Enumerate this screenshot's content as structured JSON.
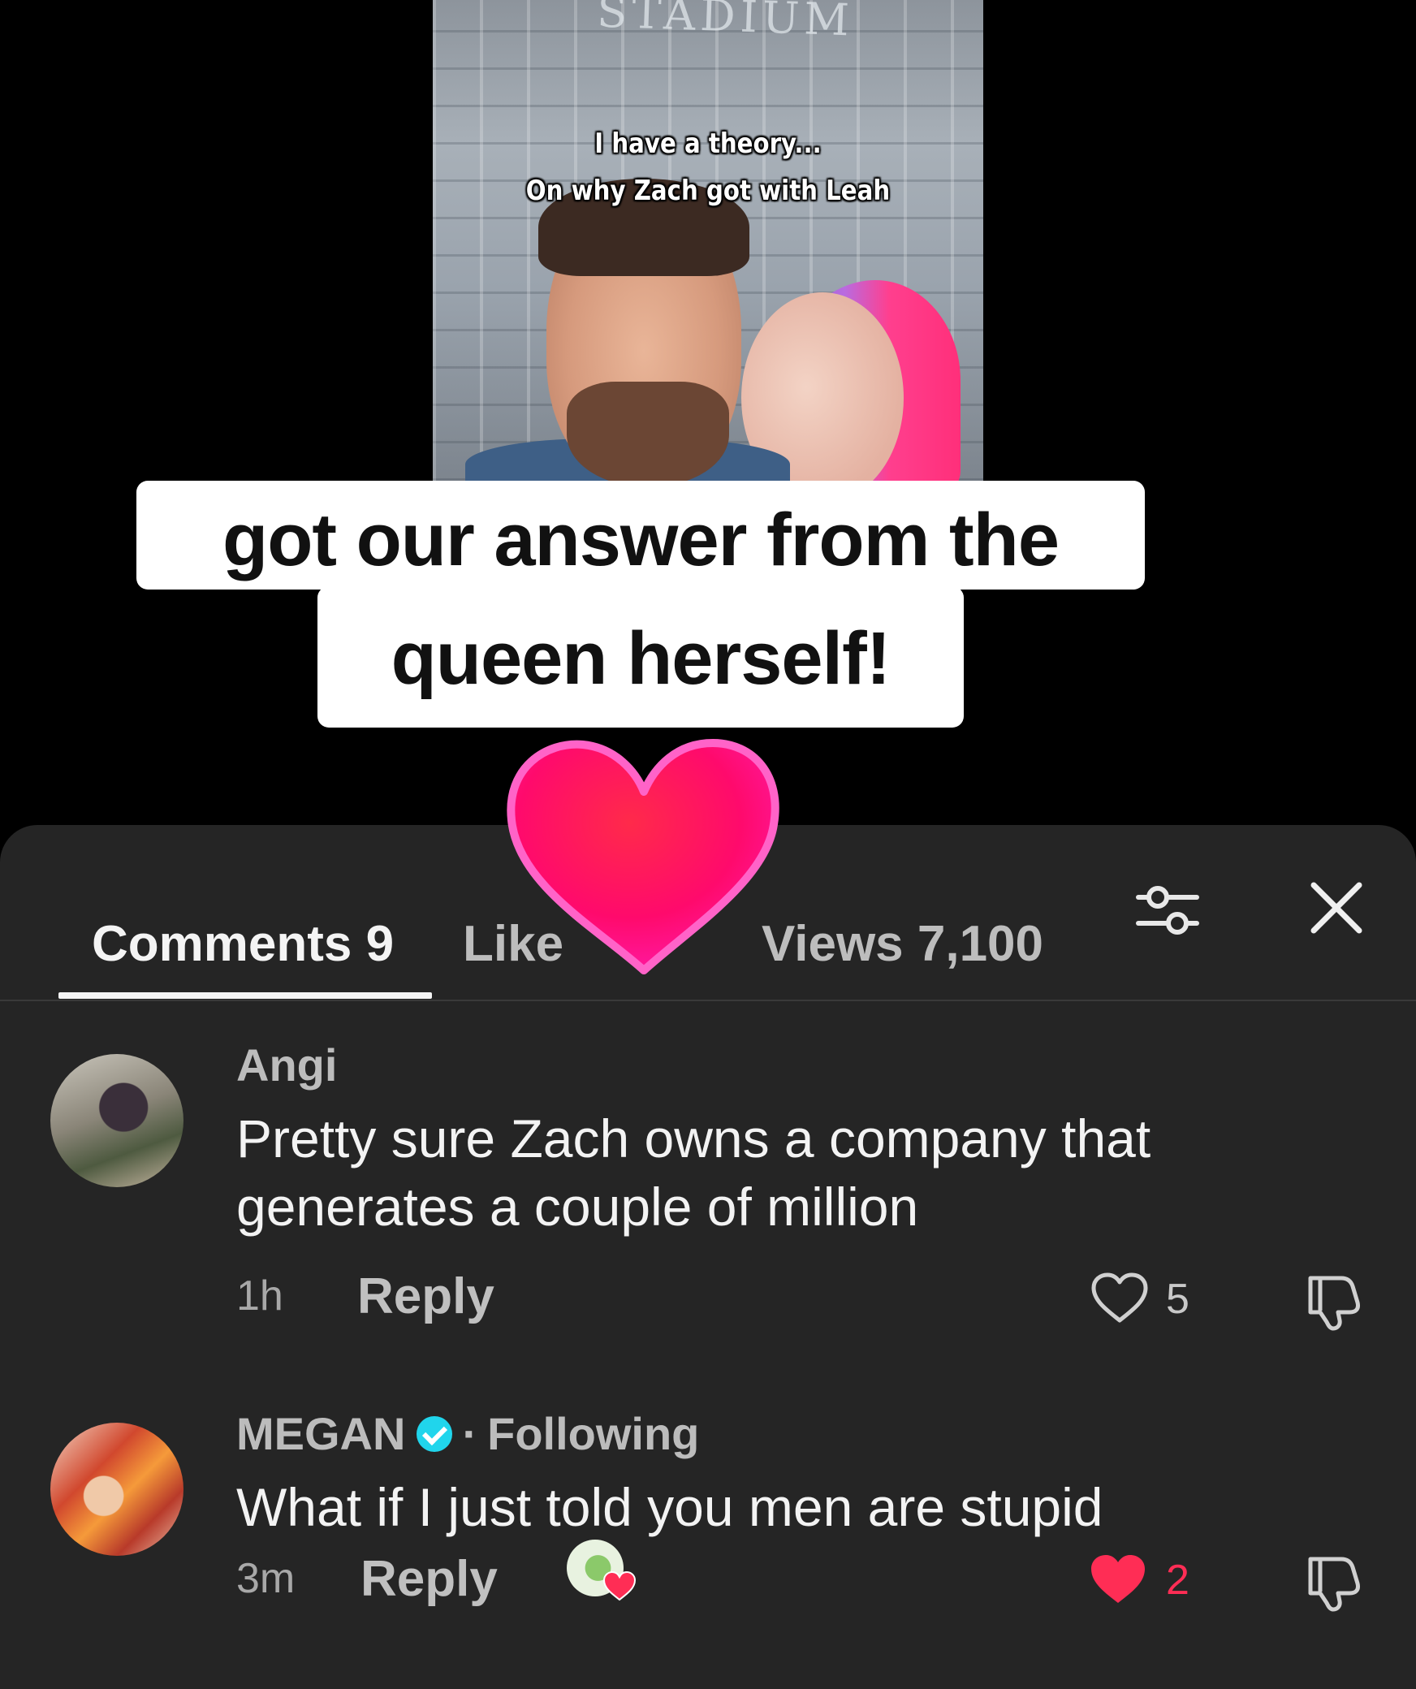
{
  "video": {
    "stadium_sign": "STADIUM",
    "theory_caption_line1": "I have a theory...",
    "theory_caption_line2": "On why Zach got with Leah",
    "caption_line1": "got our answer from the",
    "caption_line2": "queen herself!"
  },
  "tabs": {
    "comments_label": "Comments 9",
    "likes_label": "Like",
    "views_label": "Views 7,100"
  },
  "icons": {
    "filter": "filter-sliders-icon",
    "close": "close-icon",
    "overlay_heart": "heart-sticker-icon",
    "like": "heart-outline-icon",
    "liked": "heart-filled-icon",
    "dislike": "thumbs-down-icon",
    "verified": "verified-check-icon"
  },
  "colors": {
    "sheet_bg": "#252525",
    "accent_pink": "#ff2d55",
    "verified_blue": "#20d5ec",
    "heart_sticker": "#ff0a6c"
  },
  "comments": [
    {
      "author": "Angi",
      "text": "Pretty sure Zach owns a company that generates a couple of million",
      "time": "1h",
      "reply_label": "Reply",
      "likes": "5",
      "liked": false
    },
    {
      "author": "MEGAN",
      "verified": true,
      "relation": "Following",
      "separator": "·",
      "text": "What if I just told you men are stupid",
      "time": "3m",
      "reply_label": "Reply",
      "likes": "2",
      "liked": true,
      "liked_by_creator": true
    }
  ]
}
